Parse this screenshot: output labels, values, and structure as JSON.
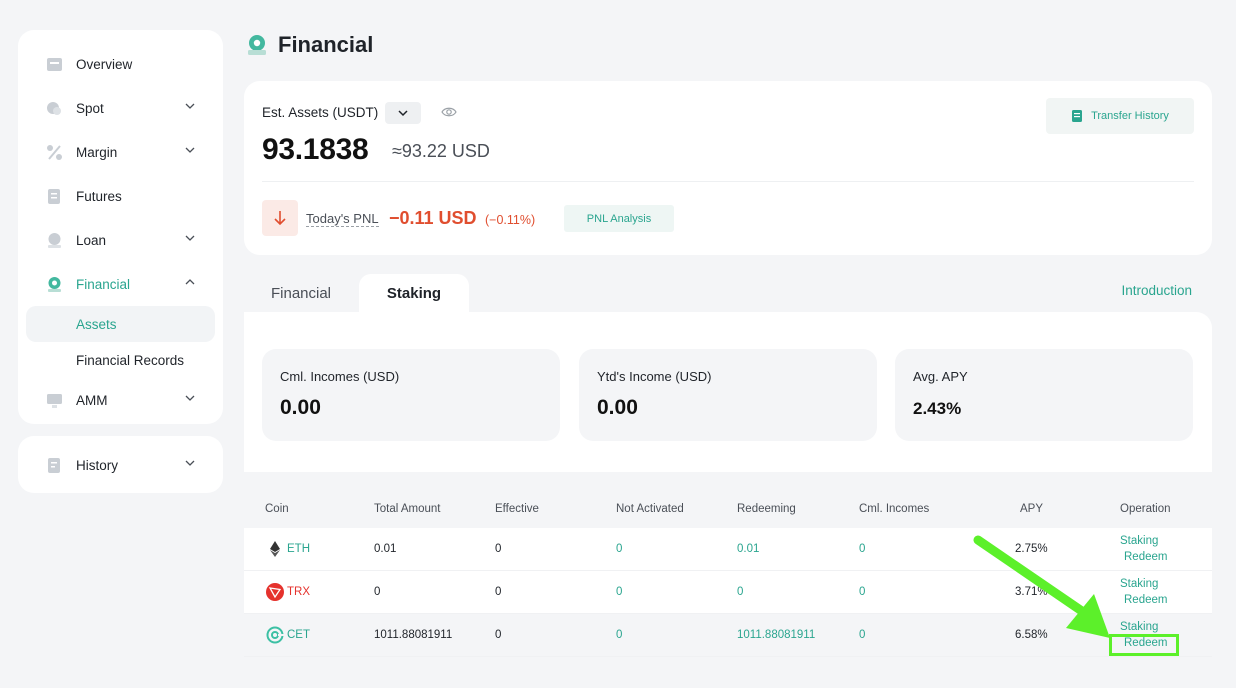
{
  "sidebar": {
    "items": [
      {
        "label": "Overview",
        "icon": "overview-icon",
        "has_chevron": false
      },
      {
        "label": "Spot",
        "icon": "spot-icon",
        "has_chevron": true
      },
      {
        "label": "Margin",
        "icon": "margin-icon",
        "has_chevron": true
      },
      {
        "label": "Futures",
        "icon": "futures-icon",
        "has_chevron": false
      },
      {
        "label": "Loan",
        "icon": "loan-icon",
        "has_chevron": true
      },
      {
        "label": "Financial",
        "icon": "financial-icon",
        "has_chevron": true,
        "expanded": true
      }
    ],
    "financial_sub": [
      {
        "label": "Assets",
        "selected": true
      },
      {
        "label": "Financial Records",
        "selected": false
      }
    ],
    "amm": {
      "label": "AMM",
      "icon": "amm-icon"
    },
    "history": {
      "label": "History",
      "icon": "history-icon"
    }
  },
  "header": {
    "title": "Financial"
  },
  "assets": {
    "est_label": "Est. Assets (USDT)",
    "amount": "93.1838",
    "usd_equiv": "≈93.22 USD",
    "transfer_history": "Transfer History",
    "pnl_label": "Today's PNL",
    "pnl_value": "−0.11 USD",
    "pnl_pct": "(−0.11%)",
    "pnl_analysis": "PNL Analysis"
  },
  "tabs": [
    {
      "label": "Financial",
      "active": false
    },
    {
      "label": "Staking",
      "active": true
    }
  ],
  "introduction": "Introduction",
  "stats": [
    {
      "label": "Cml. Incomes (USD)",
      "value": "0.00"
    },
    {
      "label": "Ytd's Income (USD)",
      "value": "0.00"
    },
    {
      "label": "Avg. APY",
      "value": "2.43%"
    }
  ],
  "table": {
    "headers": [
      "Coin",
      "Total Amount",
      "Effective",
      "Not Activated",
      "Redeeming",
      "Cml. Incomes",
      "APY",
      "Operation"
    ],
    "rows": [
      {
        "coin": "ETH",
        "total": "0.01",
        "effective": "0",
        "not_activated": "0",
        "redeeming": "0.01",
        "cml": "0",
        "apy": "2.75%",
        "op1": "Staking",
        "op2": "Redeem"
      },
      {
        "coin": "TRX",
        "total": "0",
        "effective": "0",
        "not_activated": "0",
        "redeeming": "0",
        "cml": "0",
        "apy": "3.71%",
        "op1": "Staking",
        "op2": "Redeem"
      },
      {
        "coin": "CET",
        "total": "1011.88081911",
        "effective": "0",
        "not_activated": "0",
        "redeeming": "1011.88081911",
        "cml": "0",
        "apy": "6.58%",
        "op1": "Staking",
        "op2": "Redeem"
      }
    ]
  },
  "colors": {
    "accent": "#2aa58f",
    "negative": "#e04e2f",
    "annotation": "#5cf02a"
  }
}
